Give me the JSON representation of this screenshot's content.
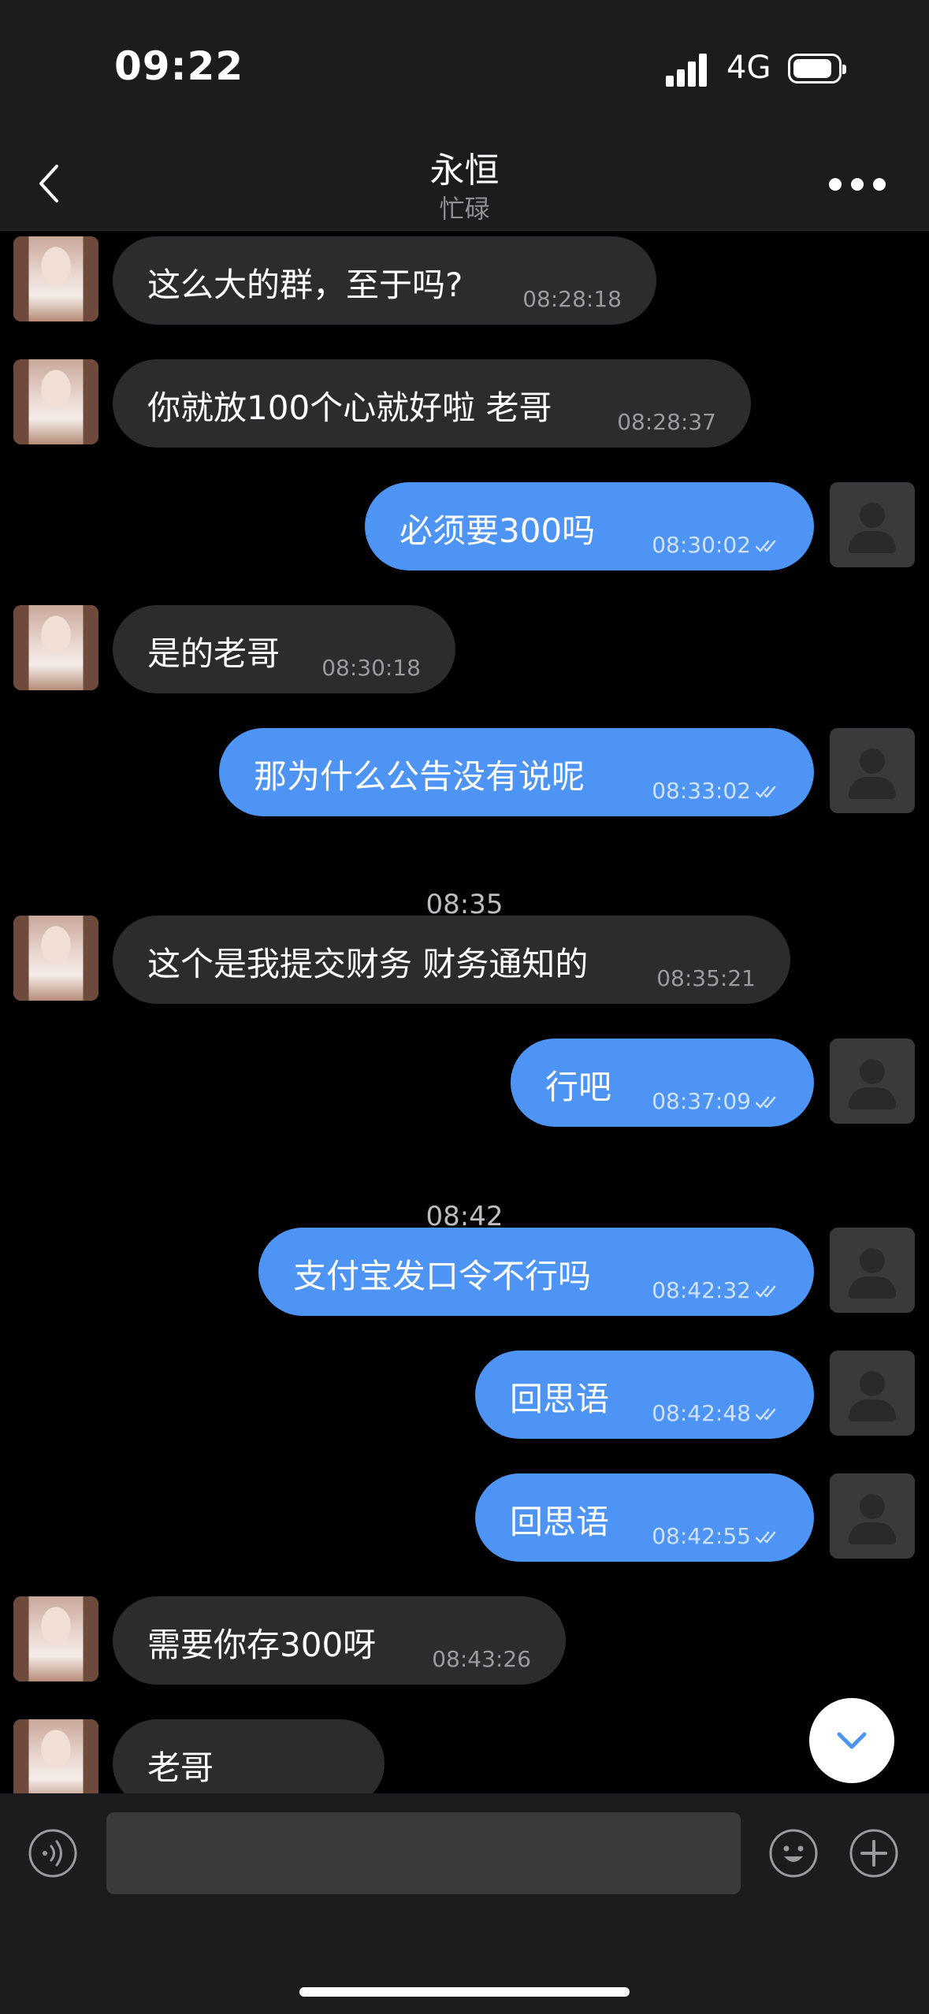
{
  "status_bar": {
    "time": "09:22",
    "network": "4G"
  },
  "header": {
    "title": "永恒",
    "subtitle": "忙碌"
  },
  "messages": [
    {
      "dir": "in",
      "text": "这么大的群，至于吗?",
      "time": "08:28:18"
    },
    {
      "dir": "in",
      "text": "你就放100个心就好啦 老哥",
      "time": "08:28:37"
    },
    {
      "dir": "out",
      "text": "必须要300吗",
      "time": "08:30:02"
    },
    {
      "dir": "in",
      "text": "是的老哥",
      "time": "08:30:18"
    },
    {
      "dir": "out",
      "text": "那为什么公告没有说呢",
      "time": "08:33:02"
    },
    {
      "dir": "divider",
      "text": "08:35"
    },
    {
      "dir": "in",
      "text": "这个是我提交财务 财务通知的",
      "time": "08:35:21"
    },
    {
      "dir": "out",
      "text": "行吧",
      "time": "08:37:09"
    },
    {
      "dir": "divider",
      "text": "08:42"
    },
    {
      "dir": "out",
      "text": "支付宝发口令不行吗",
      "time": "08:42:32"
    },
    {
      "dir": "out",
      "text": "回思语",
      "time": "08:42:48"
    },
    {
      "dir": "out",
      "text": "回思语",
      "time": "08:42:55"
    },
    {
      "dir": "in",
      "text": "需要你存300呀",
      "time": "08:43:26"
    },
    {
      "dir": "in",
      "text": "老哥",
      "time": ""
    }
  ],
  "input": {
    "placeholder": ""
  },
  "colors": {
    "outgoing_bubble": "#4d94f5",
    "incoming_bubble": "#2c2c2e",
    "background": "#000000"
  },
  "icons": [
    "back-icon",
    "more-icon",
    "read-check-icon",
    "scroll-down-icon",
    "voice-icon",
    "emoji-icon",
    "plus-icon"
  ]
}
